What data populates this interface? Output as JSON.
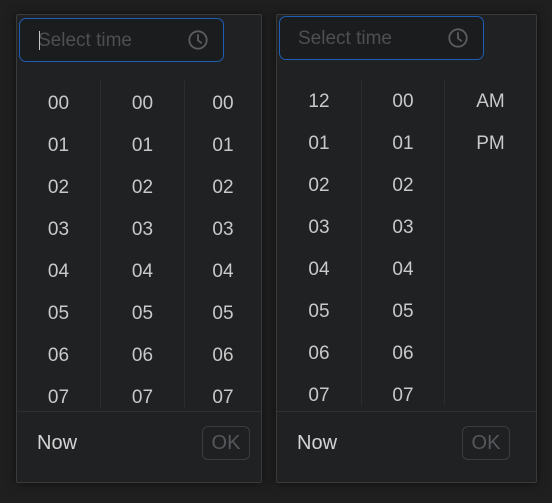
{
  "picker_24h": {
    "input": {
      "placeholder": "Select time",
      "icon": "clock-icon"
    },
    "columns": [
      {
        "name": "hours",
        "values": [
          "00",
          "01",
          "02",
          "03",
          "04",
          "05",
          "06",
          "07"
        ]
      },
      {
        "name": "minutes",
        "values": [
          "00",
          "01",
          "02",
          "03",
          "04",
          "05",
          "06",
          "07"
        ]
      },
      {
        "name": "seconds",
        "values": [
          "00",
          "01",
          "02",
          "03",
          "04",
          "05",
          "06",
          "07"
        ]
      }
    ],
    "footer": {
      "now_label": "Now",
      "ok_label": "OK"
    }
  },
  "picker_12h": {
    "input": {
      "placeholder": "Select time",
      "icon": "clock-icon"
    },
    "columns": [
      {
        "name": "hours",
        "values": [
          "12",
          "01",
          "02",
          "03",
          "04",
          "05",
          "06",
          "07"
        ]
      },
      {
        "name": "minutes",
        "values": [
          "00",
          "01",
          "02",
          "03",
          "04",
          "05",
          "06",
          "07"
        ]
      },
      {
        "name": "meridiem",
        "values": [
          "AM",
          "PM"
        ]
      }
    ],
    "footer": {
      "now_label": "Now",
      "ok_label": "OK"
    }
  },
  "colors": {
    "background": "#1f1f1f",
    "panel": "#202123",
    "accent": "#1d5fb4",
    "text": "#c9c9c9",
    "placeholder": "#4e4f52"
  }
}
